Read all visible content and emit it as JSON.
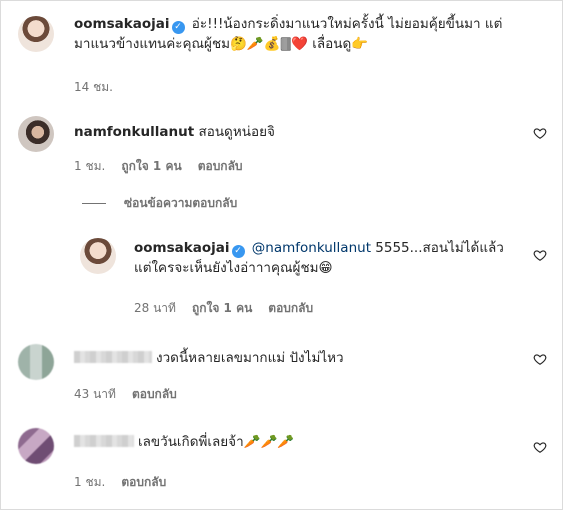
{
  "comments": [
    {
      "username": "oomsakaojai",
      "verified": true,
      "text": "อ่ะ!!!น้องกระดิ่งมาแนวใหม่ครั้งนี้ ไม่ยอมคุ้ยขี้นมา แต่มาแนวข้างแทนค่ะคุณผู้ชม🤔🥕💰🀫❤️ เลื่อนดู👉",
      "time": "14 ชม."
    },
    {
      "username": "namfonkullanut",
      "text": "สอนดูหน่อยจิ",
      "time": "1 ชม.",
      "likes": "ถูกใจ 1 คน",
      "reply_label": "ตอบกลับ"
    },
    {
      "hide_replies_label": "ซ่อนข้อความตอบกลับ"
    },
    {
      "username": "oomsakaojai",
      "verified": true,
      "mention": "@namfonkullanut",
      "text": " 5555...สอนไม่ได้แล้ว แต่ใครจะเห็นยังไงอ่าาาคุณผู้ชม😁",
      "time": "28 นาที",
      "likes": "ถูกใจ 1 คน",
      "reply_label": "ตอบกลับ"
    },
    {
      "text": "งวดนี้หลายเลขมากแม่ ปังไม่ไหว",
      "time": "43 นาที",
      "reply_label": "ตอบกลับ"
    },
    {
      "text": "เลขวันเกิดพี่เลยจ้า🥕🥕🥕",
      "time": "1 ชม.",
      "reply_label": "ตอบกลับ"
    }
  ],
  "icons": {
    "like": "heart-outline-icon",
    "verified": "verified-badge-icon"
  },
  "colors": {
    "verified": "#3897f0",
    "mention": "#00376b",
    "meta": "#737373"
  }
}
